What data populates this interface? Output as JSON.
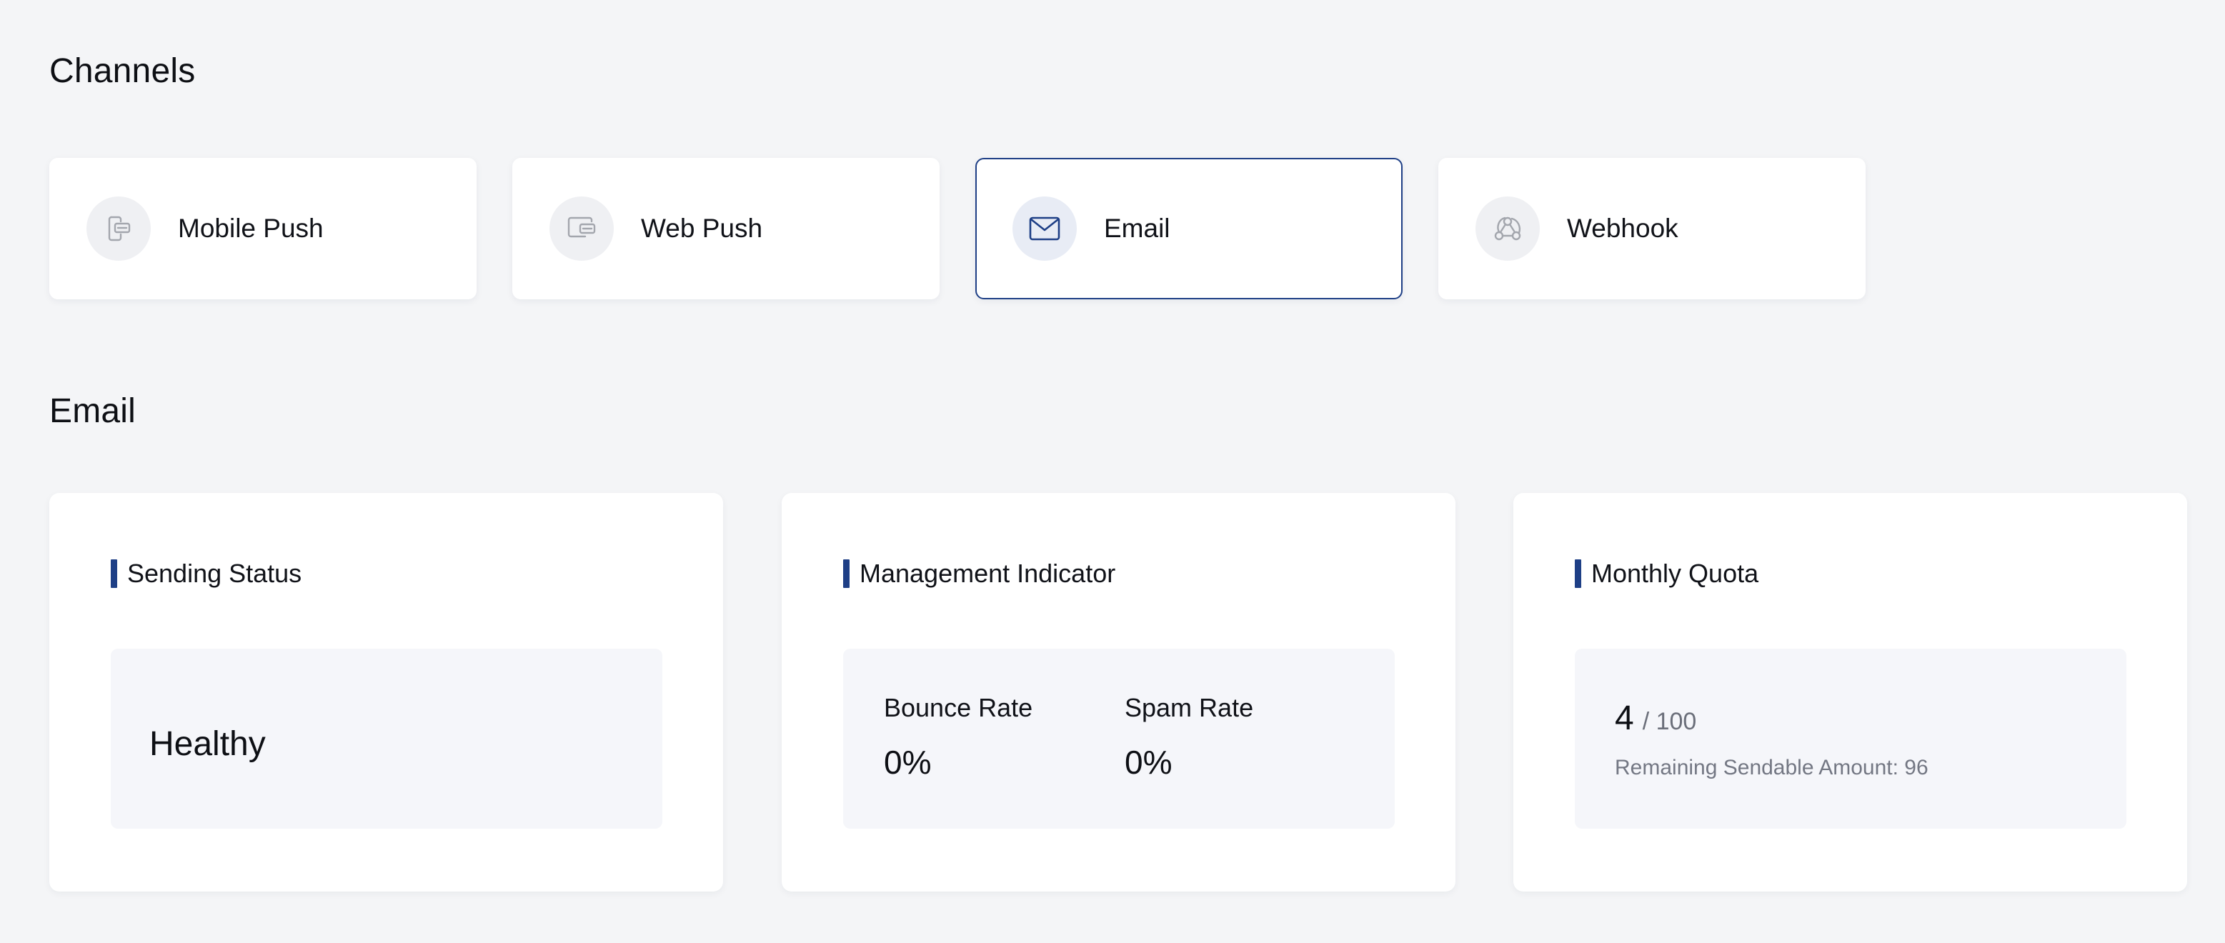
{
  "channels": {
    "title": "Channels",
    "items": [
      {
        "label": "Mobile Push",
        "icon": "mobile-push-icon",
        "selected": false
      },
      {
        "label": "Web Push",
        "icon": "web-push-icon",
        "selected": false
      },
      {
        "label": "Email",
        "icon": "mail-icon",
        "selected": true
      },
      {
        "label": "Webhook",
        "icon": "webhook-icon",
        "selected": false
      }
    ]
  },
  "email": {
    "title": "Email",
    "sending_status": {
      "title": "Sending Status",
      "value": "Healthy"
    },
    "management_indicator": {
      "title": "Management Indicator",
      "bounce_rate": {
        "label": "Bounce Rate",
        "value": "0%"
      },
      "spam_rate": {
        "label": "Spam Rate",
        "value": "0%"
      }
    },
    "monthly_quota": {
      "title": "Monthly Quota",
      "used": "4",
      "total": "/ 100",
      "remaining": "Remaining Sendable Amount: 96"
    }
  },
  "colors": {
    "accent": "#1e3f86",
    "background": "#f4f5f7",
    "icon_inactive": "#a3a6ad"
  }
}
